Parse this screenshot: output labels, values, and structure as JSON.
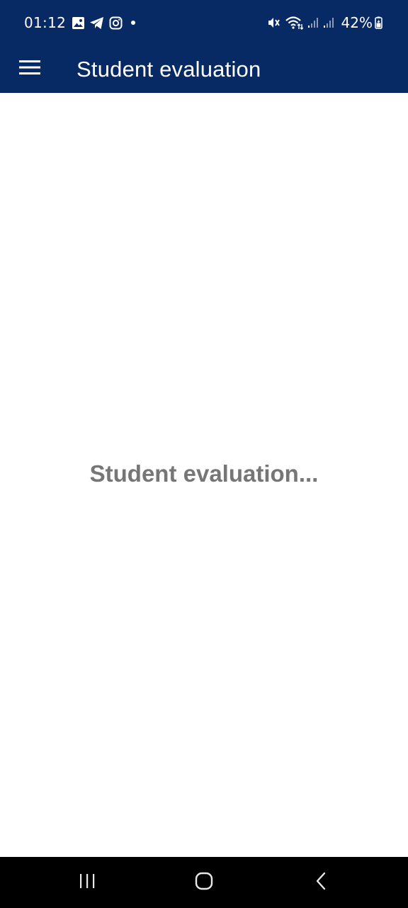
{
  "status_bar": {
    "time": "01:12",
    "battery": "42%",
    "icons_left": [
      "gallery-icon",
      "telegram-icon",
      "instagram-icon",
      "notification-dot"
    ],
    "icons_right": [
      "mute-vibrate-icon",
      "wifi-icon",
      "signal-1-icon",
      "signal-2-icon",
      "battery-charging-icon"
    ]
  },
  "app_bar": {
    "title": "Student evaluation",
    "menu_icon": "hamburger-menu-icon"
  },
  "main": {
    "loading_text": "Student evaluation..."
  },
  "nav_bar": {
    "icons": [
      "recent-apps-icon",
      "home-icon",
      "back-icon"
    ]
  },
  "colors": {
    "primary": "#072a64",
    "loading_text": "#767676",
    "background": "#ffffff",
    "nav_bar": "#000000"
  }
}
